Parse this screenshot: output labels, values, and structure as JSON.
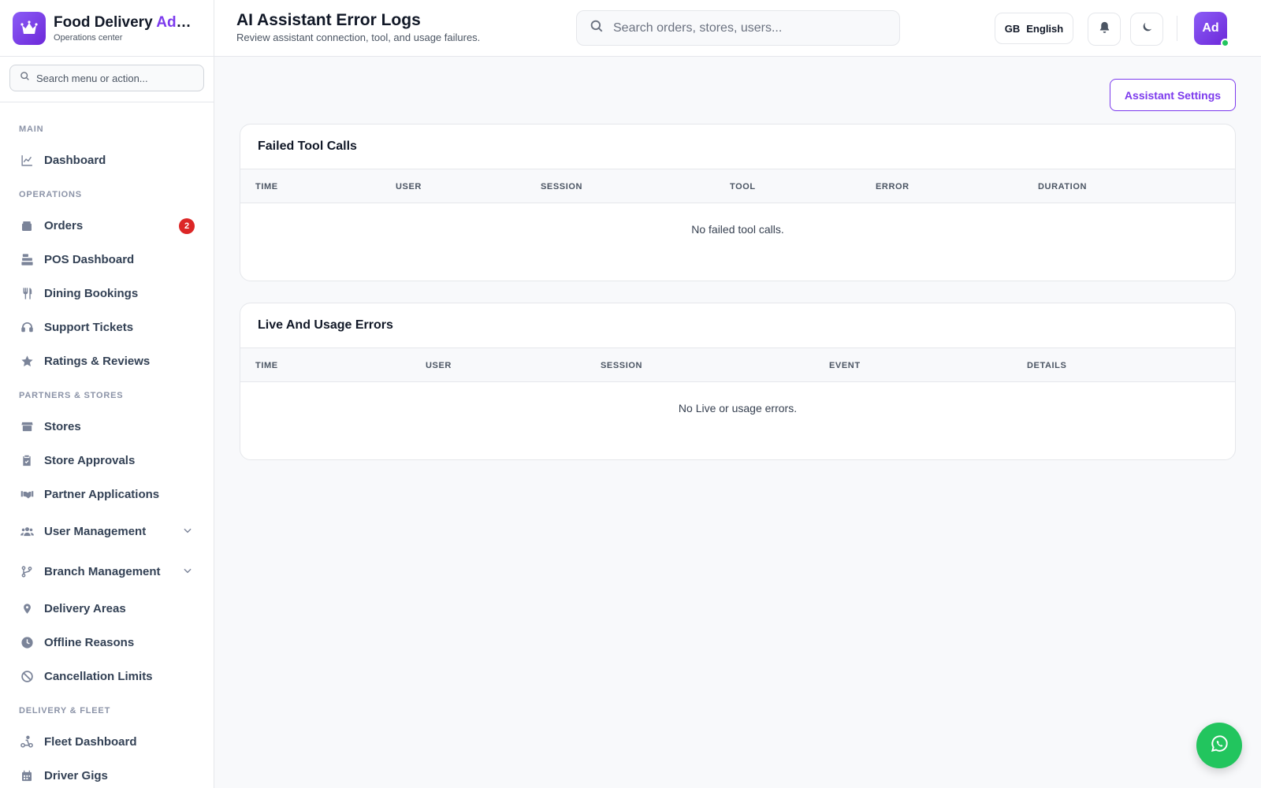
{
  "brand": {
    "title_main": "Food Delivery ",
    "title_accent": "Admin",
    "subtitle": "Operations center"
  },
  "sidebar": {
    "search_placeholder": "Search menu or action...",
    "sections": {
      "main": "MAIN",
      "operations": "OPERATIONS",
      "partners": "PARTNERS & STORES",
      "delivery": "DELIVERY & FLEET"
    },
    "items": {
      "dashboard": "Dashboard",
      "orders": "Orders",
      "orders_badge": "2",
      "pos": "POS Dashboard",
      "dining": "Dining Bookings",
      "support": "Support Tickets",
      "ratings": "Ratings & Reviews",
      "stores": "Stores",
      "store_approvals": "Store Approvals",
      "partner_apps": "Partner Applications",
      "user_mgmt": "User Management",
      "branch_mgmt": "Branch Management",
      "delivery_areas": "Delivery Areas",
      "offline_reasons": "Offline Reasons",
      "cancellation_limits": "Cancellation Limits",
      "fleet_dashboard": "Fleet Dashboard",
      "driver_gigs": "Driver Gigs"
    }
  },
  "header": {
    "title": "AI Assistant Error Logs",
    "subtitle": "Review assistant connection, tool, and usage failures.",
    "search_placeholder": "Search orders, stores, users...",
    "lang_code": "GB",
    "lang_label": "English",
    "avatar_initials": "Ad"
  },
  "actions": {
    "settings_label": "Assistant Settings"
  },
  "failed_tool_calls": {
    "title": "Failed Tool Calls",
    "columns": [
      "TIME",
      "USER",
      "SESSION",
      "TOOL",
      "ERROR",
      "DURATION"
    ],
    "empty": "No failed tool calls."
  },
  "live_usage_errors": {
    "title": "Live And Usage Errors",
    "columns": [
      "TIME",
      "USER",
      "SESSION",
      "EVENT",
      "DETAILS"
    ],
    "empty": "No Live or usage errors."
  },
  "colors": {
    "accent": "#7c3aed",
    "badge": "#dc2626",
    "whatsapp": "#22c55e",
    "online": "#22c55e"
  },
  "icons": [
    "crown-icon",
    "search-icon",
    "chart-line-icon",
    "box-icon",
    "cash-register-icon",
    "utensils-icon",
    "headset-icon",
    "star-icon",
    "store-icon",
    "clipboard-check-icon",
    "handshake-icon",
    "users-icon",
    "branch-icon",
    "map-pin-icon",
    "clock-icon",
    "ban-icon",
    "scooter-icon",
    "calendar-icon",
    "bell-icon",
    "moon-icon",
    "whatsapp-icon",
    "chevron-down-icon"
  ]
}
